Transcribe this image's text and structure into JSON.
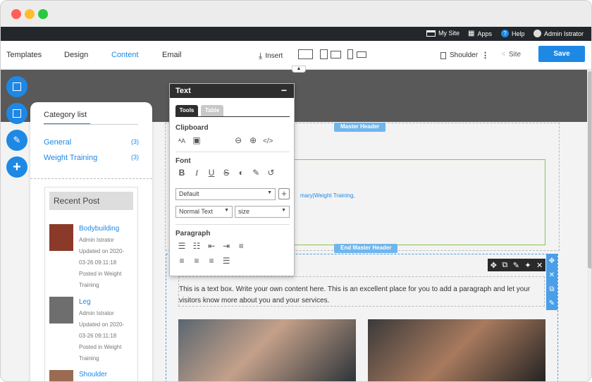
{
  "topbar": {
    "my_site": "My Site",
    "apps": "Apps",
    "help": "Help",
    "user": "Admin Istrator"
  },
  "nav": {
    "tabs": [
      "Templates",
      "Design",
      "Content",
      "Email"
    ],
    "insert": "Insert",
    "page": "Shoulder",
    "site": "Site",
    "save": "Save"
  },
  "sidebar": {
    "category_title": "Category list",
    "categories": [
      {
        "label": "General",
        "count": "(3)"
      },
      {
        "label": "Weight Training",
        "count": "(3)"
      }
    ],
    "recent_title": "Recent Post",
    "posts": [
      {
        "title": "Bodybuilding",
        "meta": [
          "Admin Istrator",
          "Updated on 2020-",
          "03-26 09:11:18",
          "Posted in Weight",
          "Training"
        ]
      },
      {
        "title": "Leg",
        "meta": [
          "Admin Istrator",
          "Updated on 2020-",
          "03-26 09:11:18",
          "Posted in Weight",
          "Training"
        ]
      },
      {
        "title": "Shoulder",
        "meta": []
      }
    ]
  },
  "panel": {
    "title": "Text",
    "collapse": "−",
    "tabs": [
      "Tools",
      "Table"
    ],
    "clipboard": "Clipboard",
    "font": "Font",
    "font_select": "Default",
    "style_select": "Normal Text",
    "size_select": "size",
    "paragraph": "Paragraph"
  },
  "page": {
    "master_header": "Master Header",
    "end_master_header": "End Master Header",
    "breadcrumb_fragment": "mary|Weight Training,",
    "textbox": "This is a text box. Write your own content here. This is an excellent place for you to add a paragraph and let your visitors know more about you and your services."
  },
  "colors": {
    "accent": "#1e88e5",
    "topbar": "#23272b",
    "tag": "#6fb6ec"
  }
}
